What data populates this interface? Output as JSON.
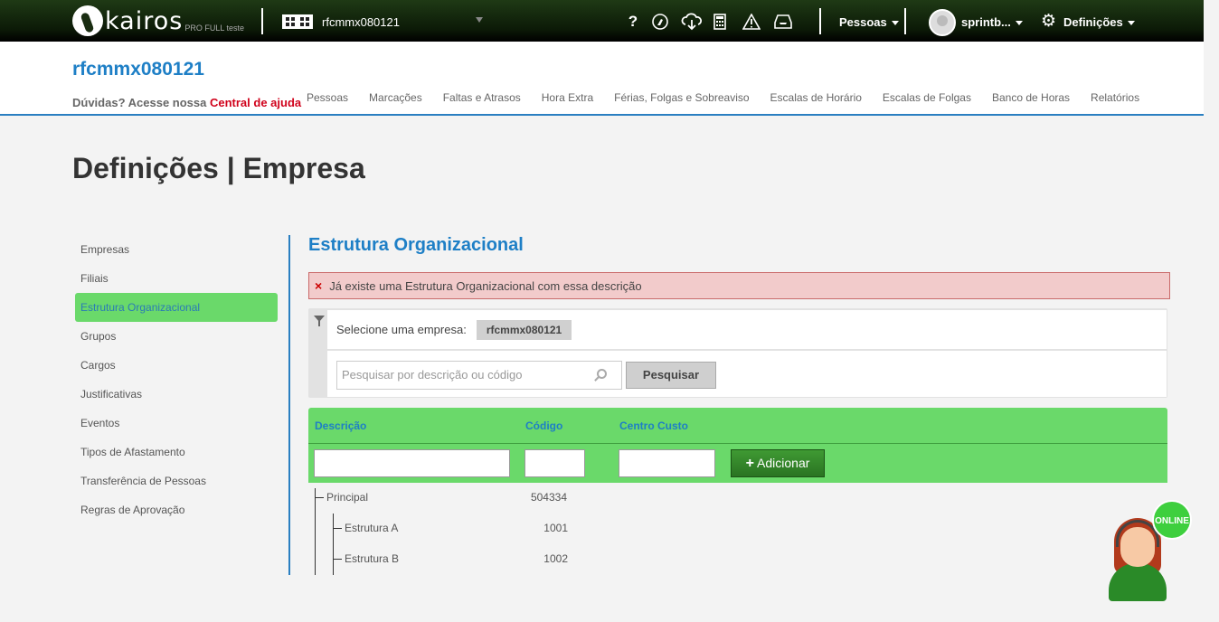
{
  "topbar": {
    "logo_text": "kairos",
    "logo_sub": "PRO FULL teste",
    "company": "rfcmmx080121",
    "icons": [
      "help-icon",
      "touch-icon",
      "cloud-download-icon",
      "calculator-icon",
      "warning-icon",
      "inbox-icon"
    ],
    "help_glyph": "?",
    "pessoas_menu": "Pessoas",
    "user_name": "sprintb...",
    "settings_menu": "Definições"
  },
  "header": {
    "company_title": "rfcmmx080121",
    "help_prefix": "Dúvidas? Acesse nossa ",
    "help_link": "Central de ajuda",
    "nav": [
      "Pessoas",
      "Marcações",
      "Faltas e Atrasos",
      "Hora Extra",
      "Férias, Folgas e Sobreaviso",
      "Escalas de Horário",
      "Escalas de Folgas",
      "Banco de Horas",
      "Relatórios"
    ]
  },
  "page_title": "Definições | Empresa",
  "sidebar": {
    "items": [
      "Empresas",
      "Filiais",
      "Estrutura Organizacional",
      "Grupos",
      "Cargos",
      "Justificativas",
      "Eventos",
      "Tipos de Afastamento",
      "Transferência de Pessoas",
      "Regras de Aprovação"
    ],
    "active": "Estrutura Organizacional"
  },
  "main": {
    "section_title": "Estrutura Organizacional",
    "alert": "Já existe uma Estrutura Organizacional com essa descrição",
    "alert_icon": "×",
    "select_company_label": "Selecione uma empresa:",
    "selected_company": "rfcmmx080121",
    "search_placeholder": "Pesquisar por descrição ou código",
    "search_button": "Pesquisar",
    "columns": [
      "Descrição",
      "Código",
      "Centro Custo"
    ],
    "add_button": "Adicionar",
    "add_icon": "+",
    "tree": [
      {
        "label": "Principal",
        "code": "504334"
      },
      {
        "label": "Estrutura A",
        "code": "1001"
      },
      {
        "label": "Estrutura B",
        "code": "1002"
      }
    ]
  },
  "chat": {
    "badge": "ONLINE"
  }
}
